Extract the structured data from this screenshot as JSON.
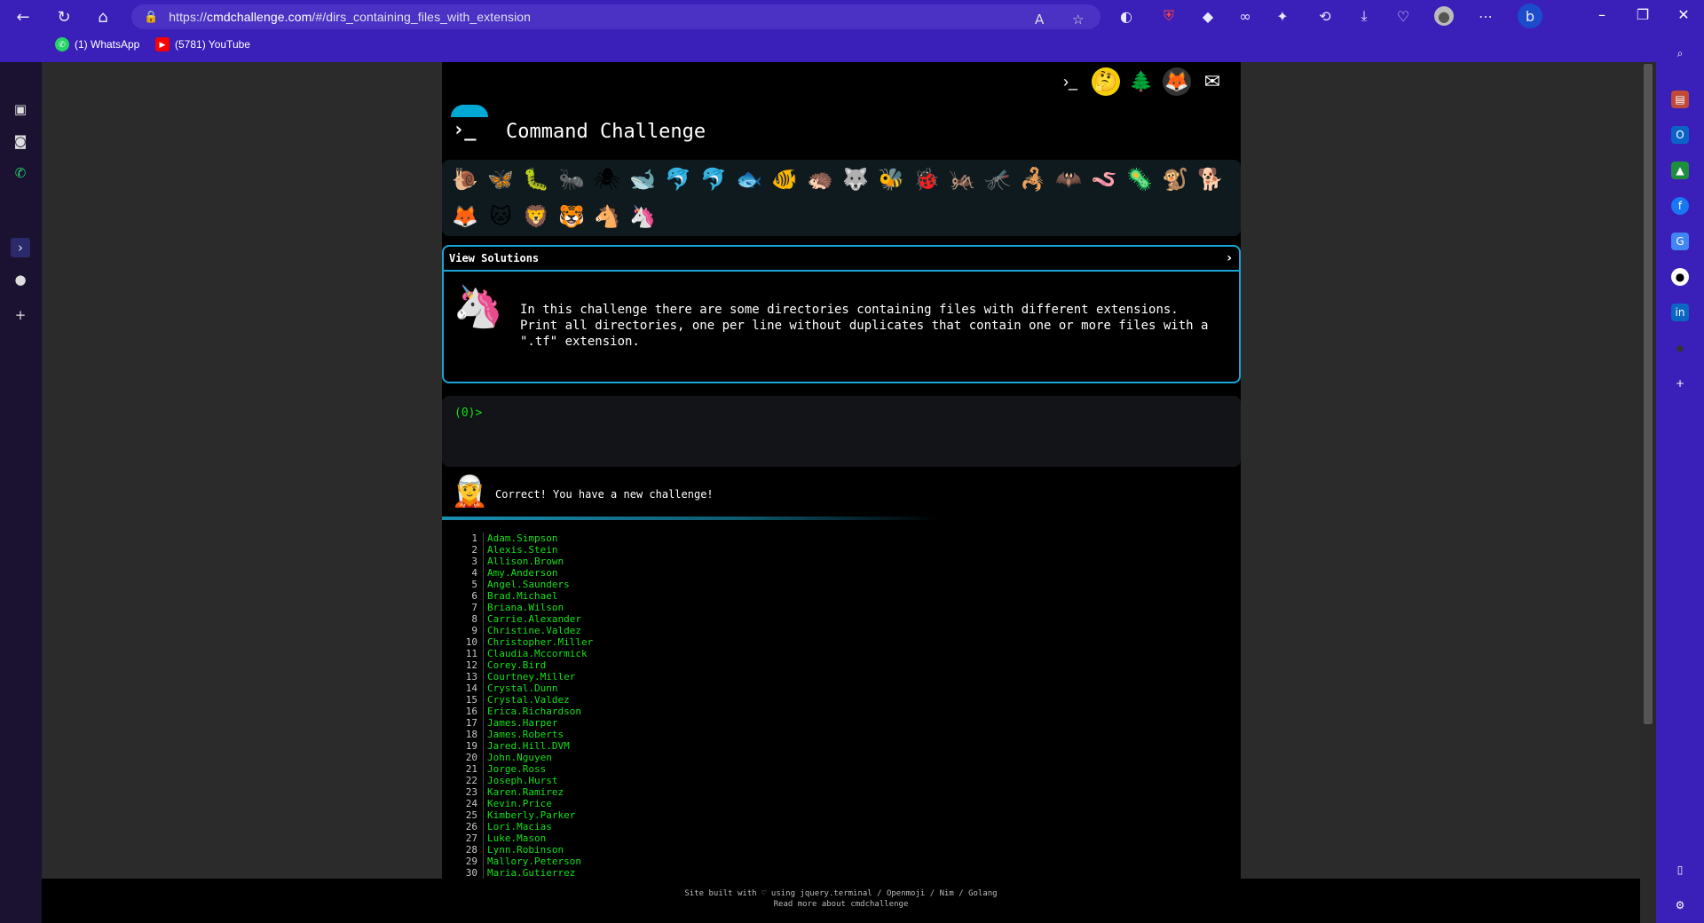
{
  "browser": {
    "url_prefix": "https://",
    "url_host": "cmdchallenge.com",
    "url_path": "/#/dirs_containing_files_with_extension",
    "bookmarks": [
      {
        "label": "(1) WhatsApp",
        "color": "#25d366"
      },
      {
        "label": "(5781) YouTube",
        "color": "#ff0000"
      }
    ]
  },
  "page": {
    "title": "Command Challenge",
    "emoji_row1": [
      "🐌",
      "🦋",
      "🐛",
      "🐜",
      "🕷",
      "🐋",
      "🐬",
      "🐬",
      "🐟",
      "🐠",
      "🦔",
      "🐺",
      "🐝",
      "🐞",
      "🦗",
      "🦟",
      "🦂",
      "🦇",
      "🪱",
      "🦠",
      "🐒",
      "🐕"
    ],
    "emoji_row2": [
      "🦊",
      "🐱",
      "🦁",
      "🐯",
      "🐴",
      "🦄"
    ],
    "solutions": {
      "header": "View Solutions",
      "description": "In this challenge there are some directories containing files with different extensions.\nPrint all directories, one per line without duplicates that contain one or more files with a\n\".tf\" extension."
    },
    "terminal_prompt": "(0)>",
    "result_message": "Correct! You have a new challenge!",
    "output_lines": [
      "Adam.Simpson",
      "Alexis.Stein",
      "Allison.Brown",
      "Amy.Anderson",
      "Angel.Saunders",
      "Brad.Michael",
      "Briana.Wilson",
      "Carrie.Alexander",
      "Christine.Valdez",
      "Christopher.Miller",
      "Claudia.Mccormick",
      "Corey.Bird",
      "Courtney.Miller",
      "Crystal.Dunn",
      "Crystal.Valdez",
      "Erica.Richardson",
      "James.Harper",
      "James.Roberts",
      "Jared.Hill.DVM",
      "John.Nguyen",
      "Jorge.Ross",
      "Joseph.Hurst",
      "Karen.Ramirez",
      "Kevin.Price",
      "Kimberly.Parker",
      "Lori.Macias",
      "Luke.Mason",
      "Lynn.Robinson",
      "Mallory.Peterson",
      "Maria.Gutierrez"
    ],
    "footer_line1": "Site built with ♡ using jquery.terminal / Openmoji / Nim / Golang",
    "footer_line2": "Read more about cmdchallenge"
  }
}
